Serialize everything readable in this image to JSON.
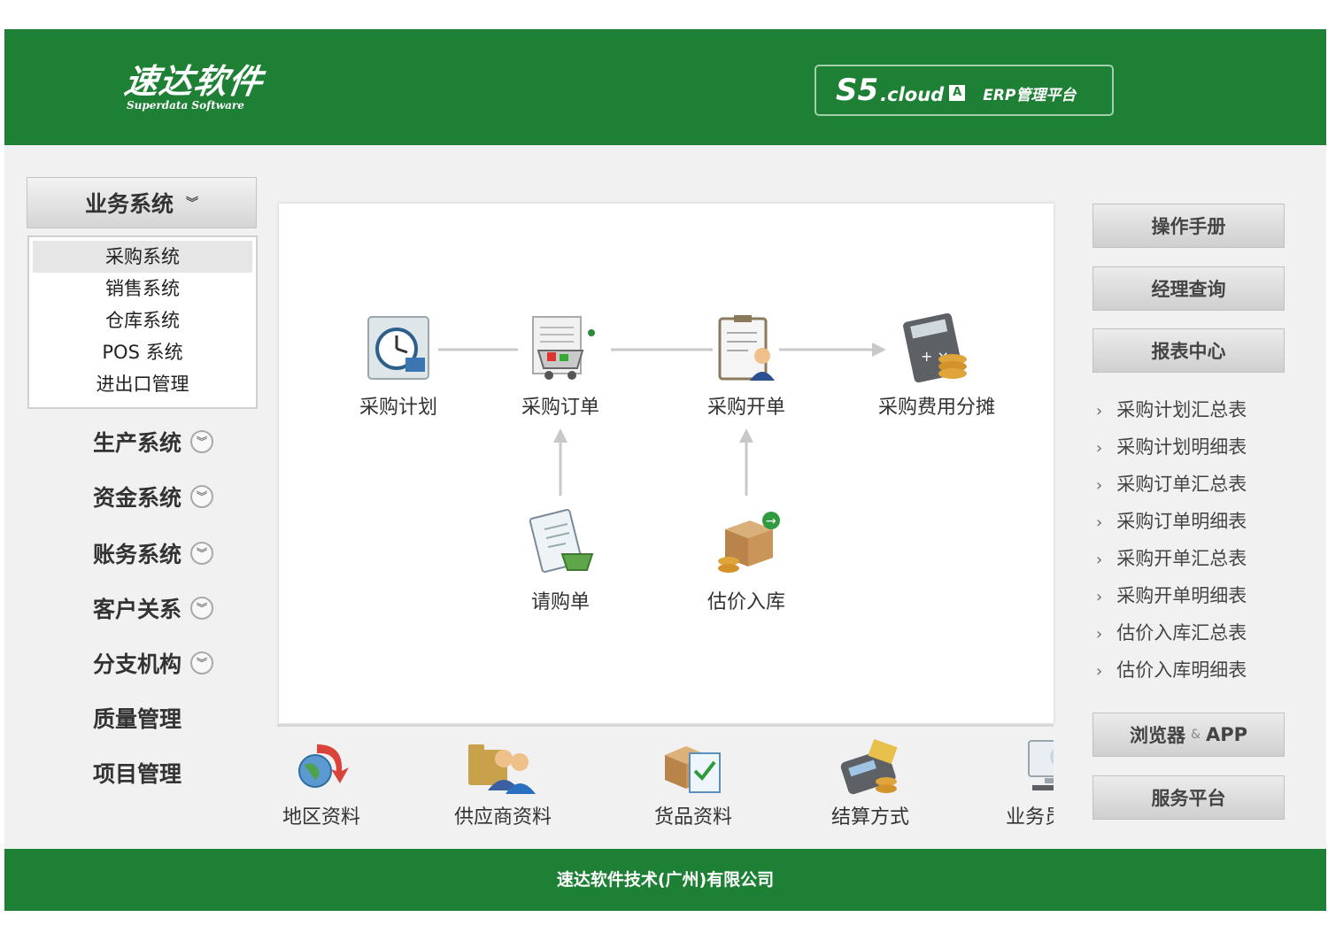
{
  "header": {
    "logo_main": "速达软件",
    "logo_sub": "Superdata Software",
    "brand_s5": "S5",
    "brand_cloud": ".cloud",
    "brand_badge": "A",
    "brand_platform": "ERP管理平台"
  },
  "sidebar": {
    "active_group": "业务系统",
    "sub_items": [
      "采购系统",
      "销售系统",
      "仓库系统",
      "POS 系统",
      "进出口管理"
    ],
    "groups": [
      "生产系统",
      "资金系统",
      "账务系统",
      "客户关系",
      "分支机构",
      "质量管理",
      "项目管理"
    ]
  },
  "flow": {
    "nodes": {
      "plan": "采购计划",
      "order": "采购订单",
      "invoice": "采购开单",
      "cost": "采购费用分摊",
      "request": "请购单",
      "estimate": "估价入库"
    }
  },
  "bottom": [
    "地区资料",
    "供应商资料",
    "货品资料",
    "结算方式",
    "业务员资料"
  ],
  "right": {
    "buttons": [
      "操作手册",
      "经理查询",
      "报表中心"
    ],
    "reports": [
      "采购计划汇总表",
      "采购计划明细表",
      "采购订单汇总表",
      "采购订单明细表",
      "采购开单汇总表",
      "采购开单明细表",
      "估价入库汇总表",
      "估价入库明细表"
    ],
    "browser_a": "浏览器",
    "browser_amp": "&",
    "browser_b": "APP",
    "service": "服务平台"
  },
  "footer": "速达软件技术(广州)有限公司",
  "colors": {
    "brand_green": "#1e8035",
    "panel_bg": "#f1f1f1"
  }
}
